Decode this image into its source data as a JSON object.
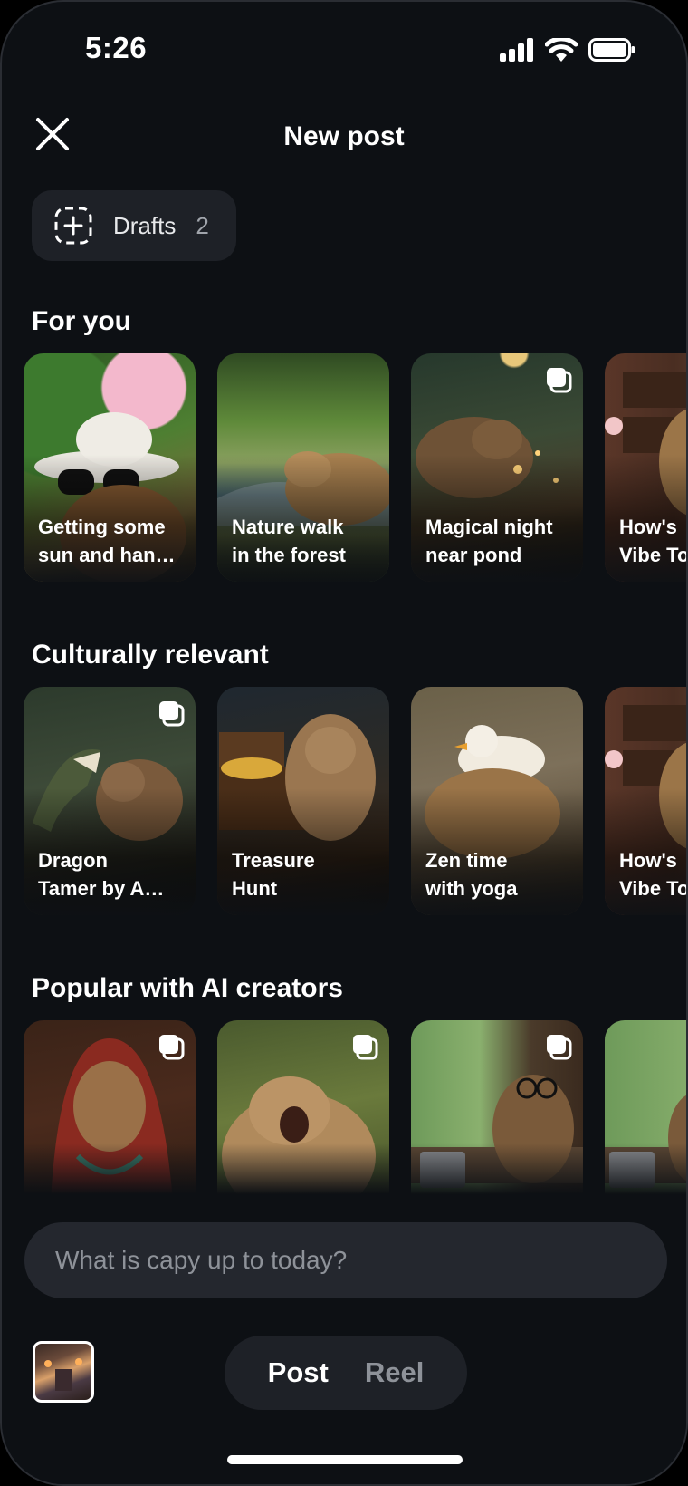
{
  "status_bar": {
    "time": "5:26"
  },
  "header": {
    "title": "New post"
  },
  "drafts": {
    "label": "Drafts",
    "count": "2"
  },
  "sections": [
    {
      "title": "For you",
      "cards": [
        {
          "label": "Getting some\nsun and han…",
          "multi": false
        },
        {
          "label": "Nature walk\nin the forest",
          "multi": false
        },
        {
          "label": "Magical night\nnear pond",
          "multi": true
        },
        {
          "label": "How's\nVibe To",
          "multi": false
        }
      ]
    },
    {
      "title": "Culturally relevant",
      "cards": [
        {
          "label": "Dragon\nTamer by A…",
          "multi": true
        },
        {
          "label": "Treasure\nHunt",
          "multi": false
        },
        {
          "label": "Zen time\nwith yoga",
          "multi": false
        },
        {
          "label": "How's\nVibe To",
          "multi": false
        }
      ]
    },
    {
      "title": "Popular with AI creators",
      "cards": [
        {
          "label": "",
          "multi": true
        },
        {
          "label": "",
          "multi": true
        },
        {
          "label": "",
          "multi": true
        },
        {
          "label": "",
          "multi": false
        }
      ]
    }
  ],
  "composer": {
    "placeholder": "What is capy up to today?"
  },
  "mode_switch": {
    "post": "Post",
    "reel": "Reel"
  }
}
